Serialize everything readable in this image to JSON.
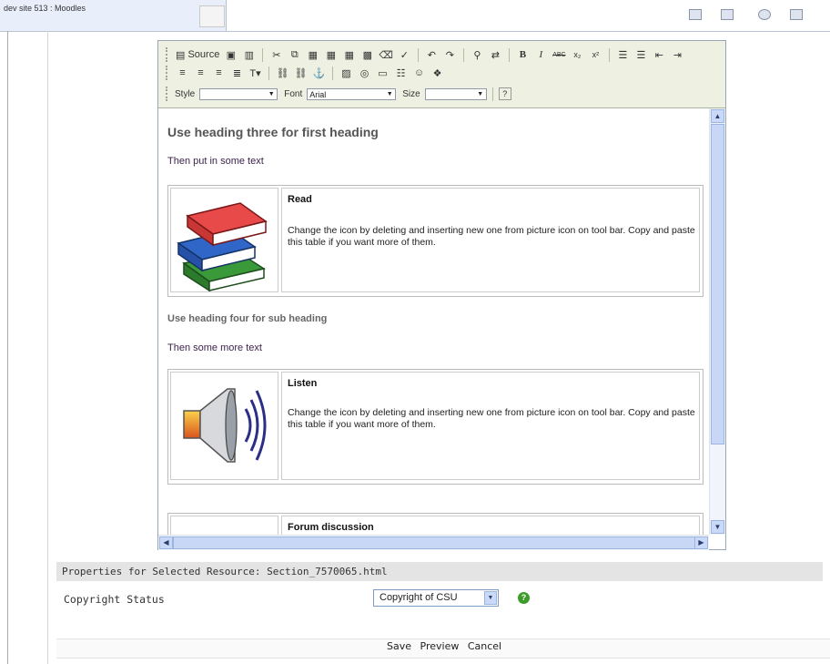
{
  "window": {
    "title": "dev site 513 : Moodles"
  },
  "toolbar": {
    "source_label": "Source",
    "style_label": "Style",
    "style_value": "",
    "font_label": "Font",
    "font_value": "Arial",
    "size_label": "Size",
    "size_value": ""
  },
  "content": {
    "heading3": "Use heading three for first heading",
    "text1": "Then put in some text",
    "box1": {
      "title": "Read",
      "body": "Change the icon by deleting and inserting new one from picture icon on tool bar. Copy and paste this table if you want more of them.",
      "icon": "books-icon"
    },
    "heading4": "Use heading four for sub heading",
    "text2": "Then some more text",
    "box2": {
      "title": "Listen",
      "body": "Change the icon by deleting and inserting new one from picture icon on tool bar. Copy and paste this table if you want more of them.",
      "icon": "speaker-icon"
    },
    "box3": {
      "title": "Forum discussion",
      "icon": "forum-icon"
    }
  },
  "properties": {
    "header": "Properties for Selected Resource: Section_7570065.html",
    "copyright_label": "Copyright Status",
    "copyright_value": "Copyright of CSU"
  },
  "actions": {
    "save": "Save",
    "preview": "Preview",
    "cancel": "Cancel"
  },
  "colors": {
    "toolbar_bg": "#eef0e2",
    "scroll": "#c7d7f5",
    "help_icon": "#3c9c2a"
  }
}
